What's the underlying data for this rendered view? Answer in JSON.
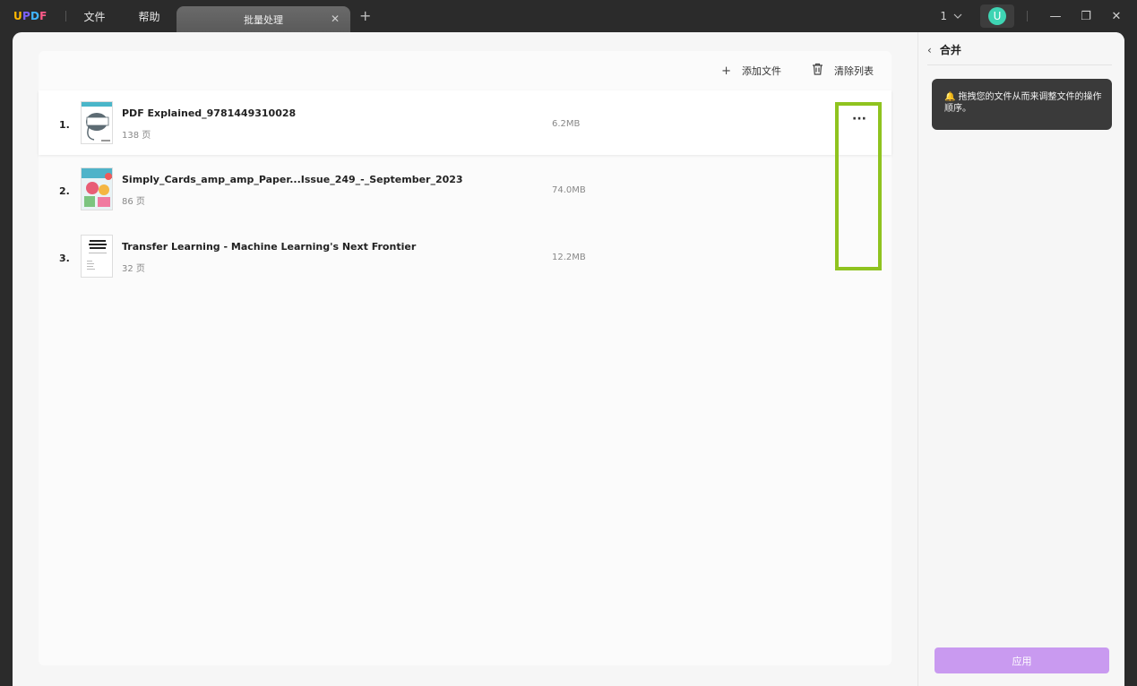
{
  "app": {
    "logo": {
      "u": "U",
      "p": "P",
      "d": "D",
      "f": "F"
    },
    "menu": [
      "文件",
      "帮助"
    ],
    "tab_title": "批量处理",
    "tab_close": "✕",
    "tab_add": "+",
    "page_count": "1",
    "avatar_letter": "U",
    "window": {
      "minimize": "—",
      "restore": "❐",
      "close": "✕"
    }
  },
  "toolbar": {
    "add_icon": "+",
    "add_label": "添加文件",
    "clear_icon": "🗑",
    "clear_label": "清除列表"
  },
  "files": [
    {
      "index": "1.",
      "name": "PDF Explained_9781449310028",
      "pages": "138 页",
      "size": "6.2MB",
      "more": "···"
    },
    {
      "index": "2.",
      "name": "Simply_Cards_amp_amp_Paper...Issue_249_-_September_2023",
      "pages": "86 页",
      "size": "74.0MB"
    },
    {
      "index": "3.",
      "name": "Transfer Learning - Machine Learning's Next Frontier",
      "pages": "32 页",
      "size": "12.2MB"
    }
  ],
  "side": {
    "back": "‹",
    "title": "合并",
    "hint_icon": "🔔",
    "hint": "拖拽您的文件从而来调整文件的操作顺序。",
    "apply": "应用"
  },
  "colors": {
    "accent_apply": "#c99af0",
    "highlight": "#8fc31f",
    "avatar": "#3ed4b3"
  }
}
